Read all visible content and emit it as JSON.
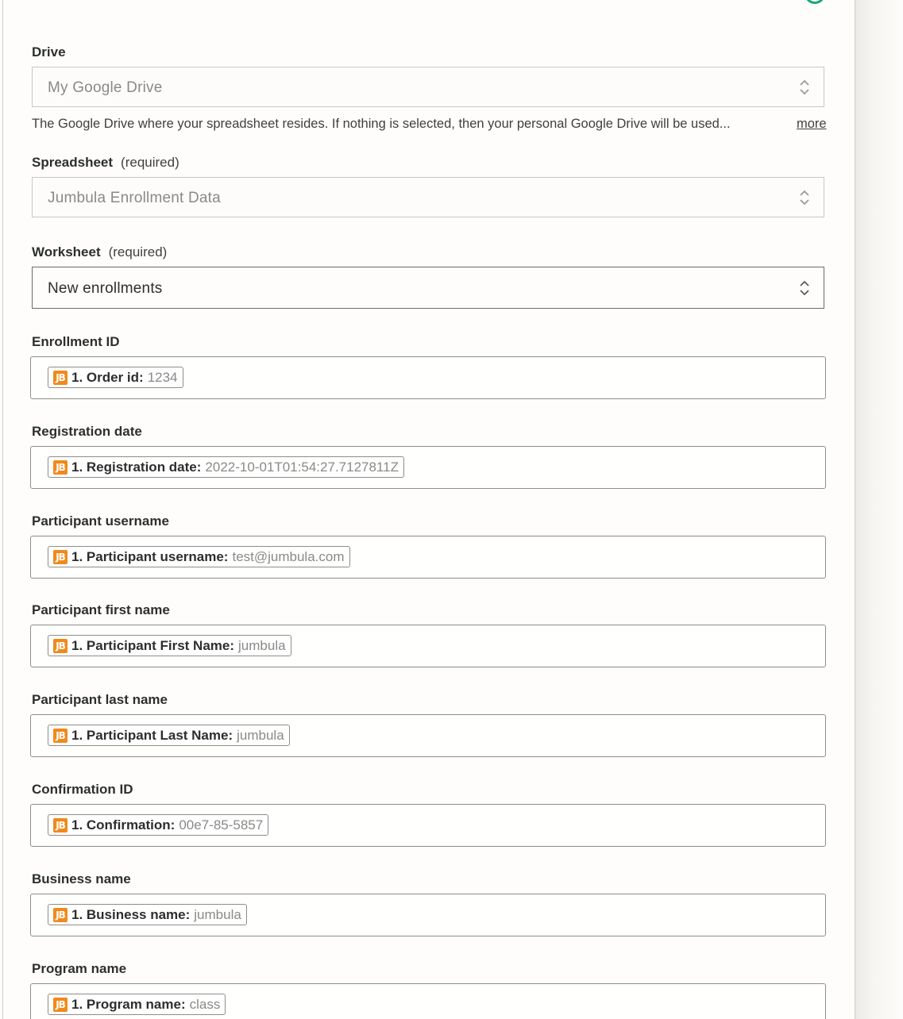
{
  "fields": {
    "drive": {
      "label": "Drive",
      "value": "My Google Drive",
      "help": "The Google Drive where your spreadsheet resides. If nothing is selected, then your personal Google Drive will be used...",
      "more": "more"
    },
    "spreadsheet": {
      "label": "Spreadsheet",
      "required": "(required)",
      "value": "Jumbula Enrollment Data"
    },
    "worksheet": {
      "label": "Worksheet",
      "required": "(required)",
      "value": "New enrollments"
    }
  },
  "app_icon": {
    "text": "JB",
    "color": "#f08a1c"
  },
  "mappings": [
    {
      "label": "Enrollment ID",
      "key": "1. Order id:",
      "value": "1234"
    },
    {
      "label": "Registration date",
      "key": "1. Registration date:",
      "value": "2022-10-01T01:54:27.7127811Z"
    },
    {
      "label": "Participant username",
      "key": "1. Participant username:",
      "value": "test@jumbula.com"
    },
    {
      "label": "Participant first name",
      "key": "1. Participant First Name:",
      "value": "jumbula"
    },
    {
      "label": "Participant last name",
      "key": "1. Participant Last Name:",
      "value": "jumbula"
    },
    {
      "label": "Confirmation ID",
      "key": "1. Confirmation:",
      "value": "00e7-85-5857"
    },
    {
      "label": "Business name",
      "key": "1. Business name:",
      "value": "jumbula"
    },
    {
      "label": "Program name",
      "key": "1. Program name:",
      "value": "class"
    }
  ]
}
